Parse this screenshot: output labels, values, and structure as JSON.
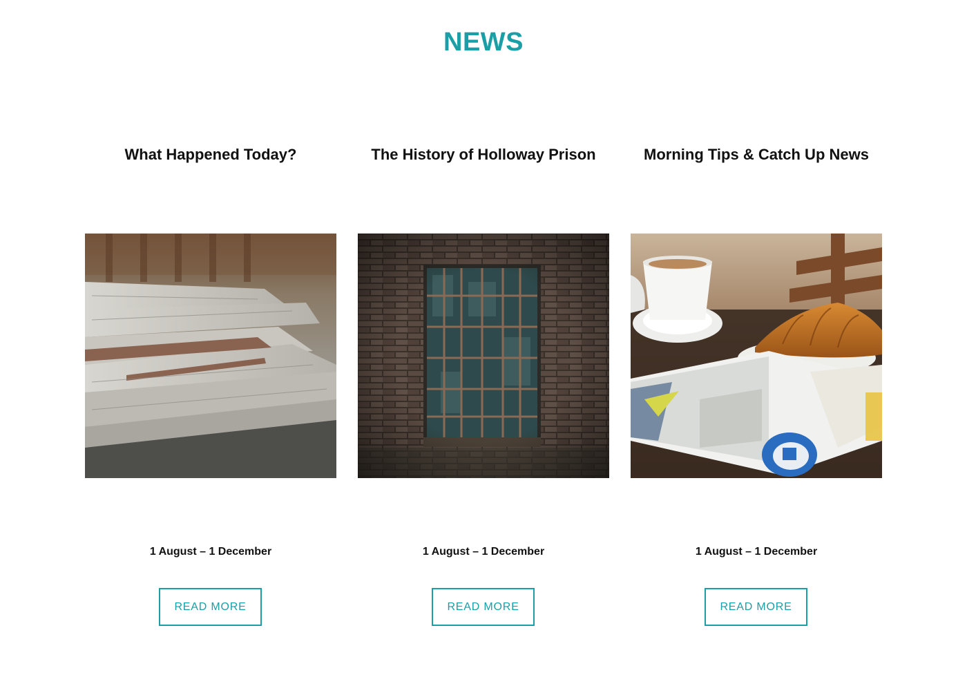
{
  "section": {
    "title": "NEWS",
    "accent_color": "#1a9fa6"
  },
  "cards": [
    {
      "title": "What Happened Today?",
      "image": "newspapers-stack-photo",
      "date": "1 August – 1 December",
      "button_label": "READ MORE"
    },
    {
      "title": "The History of Holloway Prison",
      "image": "barred-window-brick-wall-photo",
      "date": "1 August – 1 December",
      "button_label": "READ MORE"
    },
    {
      "title": "Morning Tips & Catch Up News",
      "image": "coffee-croissant-magazine-photo",
      "date": "1 August – 1 December",
      "button_label": "READ MORE"
    }
  ]
}
